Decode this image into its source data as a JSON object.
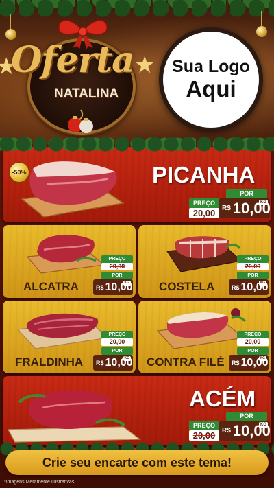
{
  "header": {
    "badge_title": "Oferta",
    "badge_subtitle": "NATALINA",
    "logo_line1": "Sua Logo",
    "logo_line2": "Aqui"
  },
  "colors": {
    "red_card": "#c92a14",
    "yellow_card": "#e9bb2c",
    "price_green": "#2f8c35",
    "price_brown": "#5b2410"
  },
  "labels": {
    "preco": "PREÇO",
    "por": "POR",
    "currency": "R$",
    "unit": "KG"
  },
  "products": {
    "picanha": {
      "name": "PICANHA",
      "discount": "-50%",
      "old_price": "20,00",
      "new_price": "10,00"
    },
    "alcatra": {
      "name": "ALCATRA",
      "old_price": "20,00",
      "new_price": "10,00"
    },
    "costela": {
      "name": "COSTELA",
      "old_price": "20,00",
      "new_price": "10,00"
    },
    "fraldinha": {
      "name": "FRALDINHA",
      "old_price": "20,00",
      "new_price": "10,00"
    },
    "contra_file": {
      "name": "CONTRA FILÉ",
      "old_price": "20,00",
      "new_price": "10,00"
    },
    "acem": {
      "name": "ACÉM",
      "old_price": "20,00",
      "new_price": "10,00"
    }
  },
  "footer": {
    "cta": "Crie seu encarte com este tema!",
    "disclaimer": "*Imagens Meramente Ilustrativas"
  }
}
